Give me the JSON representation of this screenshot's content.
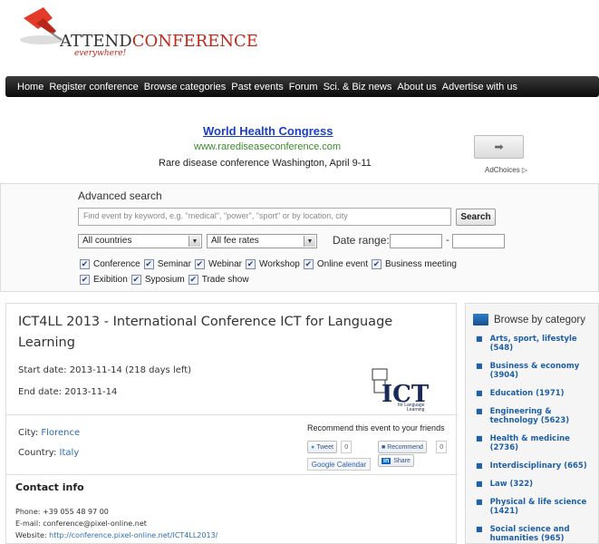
{
  "logo": {
    "text_start": "ATTEND",
    "text_end": "CONFERENCE",
    "tagline": "everywhere!"
  },
  "nav": [
    "Home",
    "Register conference",
    "Browse categories",
    "Past events",
    "Forum",
    "Sci. & Biz news",
    "About us",
    "Advertise with us"
  ],
  "ad": {
    "title": "World Health Congress",
    "url": "www.rarediseaseconference.com",
    "description": "Rare disease conference Washington, April 9-11",
    "adchoices": "AdChoices"
  },
  "search": {
    "title": "Advanced search",
    "placeholder": "Find event by keyword, e.g. \"medical\", \"power\", \"sport\" or by location, city",
    "button": "Search",
    "country": "All countries",
    "fee": "All fee rates",
    "date_label": "Date range:",
    "types_row1": [
      "Conference",
      "Seminar",
      "Webinar",
      "Workshop",
      "Online event",
      "Business meeting"
    ],
    "types_row2": [
      "Exibition",
      "Syposium",
      "Trade show"
    ]
  },
  "event": {
    "title": "ICT4LL 2013 - International Conference ICT for Language Learning",
    "start": "Start date: 2013-11-14 (218 days left)",
    "end": "End date:  2013-11-14",
    "city_label": "City: ",
    "city": "Florence",
    "country_label": "Country: ",
    "country": "Italy",
    "recommend": "Recommend this event to your friends",
    "tweet": "Tweet",
    "tweet_count": "0",
    "fb_recommend": "Recommend",
    "fb_count": "0",
    "share": "Share",
    "gcal": "Google Calendar",
    "logo_text": "ICT",
    "logo_sub": "for Language Learning"
  },
  "contact": {
    "heading": "Contact info",
    "phone": "Phone: +39 055 48 97 00",
    "email": "E-mail: conference@pixel-online.net",
    "website_label": "Website: ",
    "website": "http://conference.pixel-online.net/ICT4LL2013/"
  },
  "sidebar": {
    "heading": "Browse by category",
    "items": [
      "Arts, sport, lifestyle (548)",
      "Business & economy (3904)",
      "Education (1971)",
      "Engineering & technology (5623)",
      "Health & medicine (2736)",
      "Interdisciplinary (665)",
      "Law (322)",
      "Physical & life science (1421)",
      "Social science and humanities (965)"
    ]
  }
}
